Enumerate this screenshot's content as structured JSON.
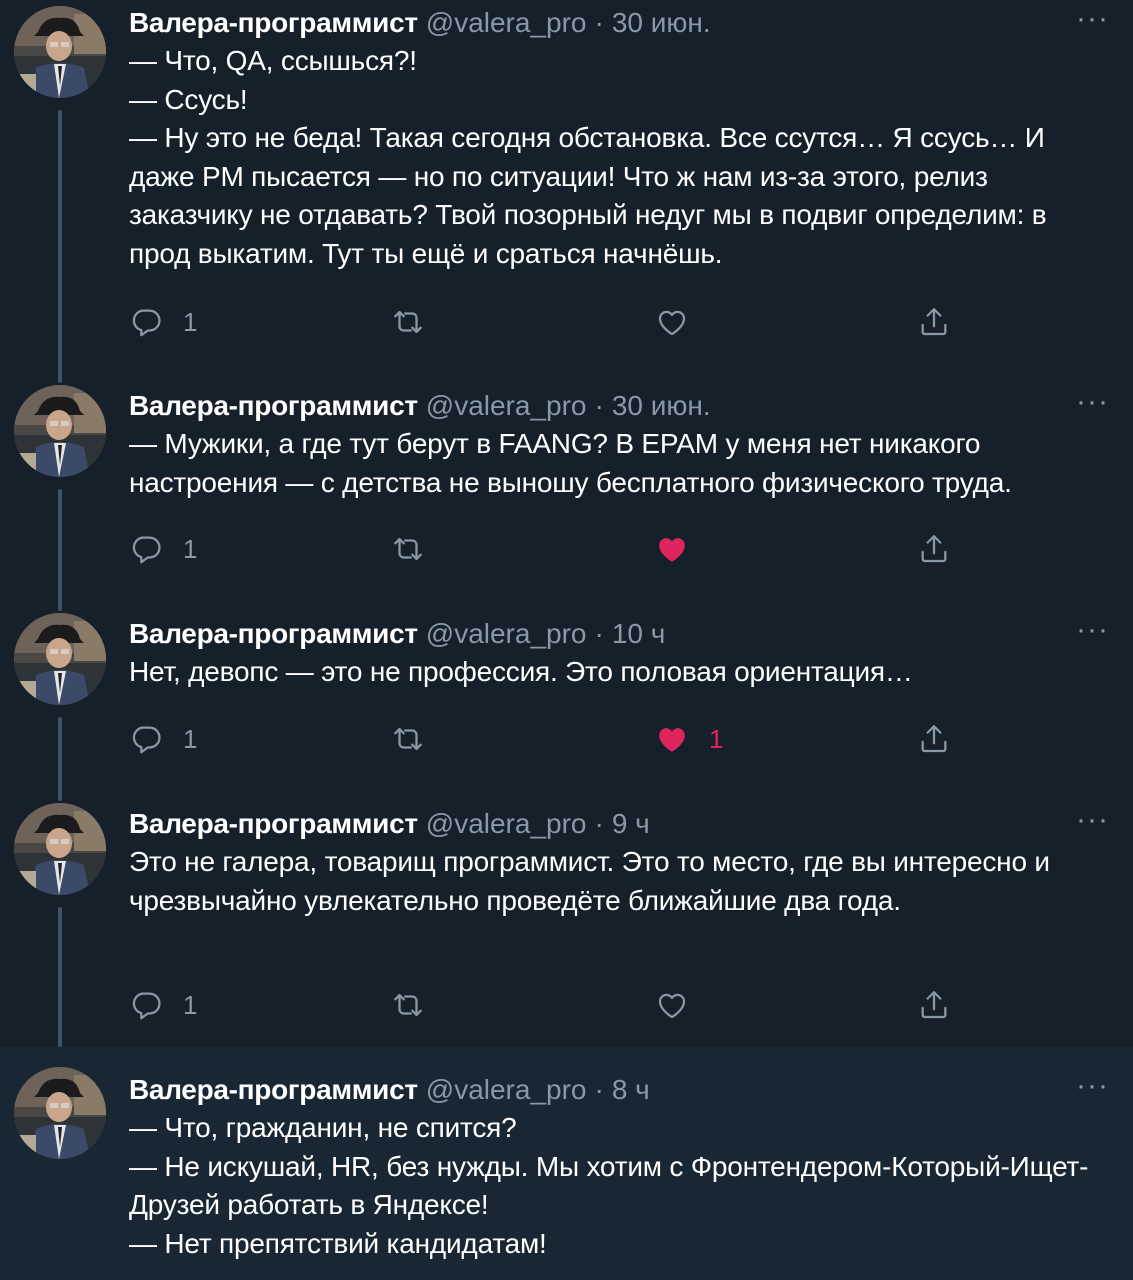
{
  "tweets": [
    {
      "name": "Валера-программист",
      "handle": "@valera_pro",
      "sep": "·",
      "time": "30 июн.",
      "lines": [
        "— Что, QA, ссышься?!",
        "— Ссусь!",
        "— Ну это не беда! Такая сегодня обстановка. Все ссутся… Я ссусь… И даже PM пысается — но по ситуации! Что ж нам из-за этого, релиз заказчику не отдавать? Твой позорный недуг мы в подвиг определим: в прод выкатим. Тут ты ещё и сраться начнёшь."
      ],
      "replies": "1",
      "retweets": "",
      "likes": "",
      "liked": false
    },
    {
      "name": "Валера-программист",
      "handle": "@valera_pro",
      "sep": "·",
      "time": "30 июн.",
      "lines": [
        "— Мужики, а где тут берут в FAANG? В EPAM у меня нет никакого настроения — с детства не выношу бесплатного физического труда."
      ],
      "replies": "1",
      "retweets": "",
      "likes": "",
      "liked": true
    },
    {
      "name": "Валера-программист",
      "handle": "@valera_pro",
      "sep": "·",
      "time": "10 ч",
      "lines": [
        "Нет, девопс — это не профессия. Это половая ориентация…"
      ],
      "replies": "1",
      "retweets": "",
      "likes": "1",
      "liked": true
    },
    {
      "name": "Валера-программист",
      "handle": "@valera_pro",
      "sep": "·",
      "time": "9 ч",
      "lines": [
        "Это не галера, товарищ программист. Это то место, где вы интересно и чрезвычайно увлекательно проведёте ближайшие два года."
      ],
      "replies": "1",
      "retweets": "",
      "likes": "",
      "liked": false
    },
    {
      "name": "Валера-программист",
      "handle": "@valera_pro",
      "sep": "·",
      "time": "8 ч",
      "lines": [
        "— Что, гражданин, не спится?",
        "— Не искушай, HR, без нужды. Мы хотим с Фронтендером-Который-Ищет-Друзей работать в Яндексе!",
        "— Нет препятствий кандидатам!"
      ],
      "replies": "",
      "retweets": "",
      "likes": "",
      "liked": false
    }
  ],
  "icons": {
    "reply": "reply-icon",
    "retweet": "retweet-icon",
    "like": "heart-icon",
    "share": "share-icon",
    "more": "more-icon"
  },
  "more_glyph": "···",
  "colors": {
    "background": "#15202b",
    "highlight_background": "#192734",
    "secondary_text": "#8899a6",
    "like_active": "#e0245e",
    "thread_line": "#3d5466"
  }
}
